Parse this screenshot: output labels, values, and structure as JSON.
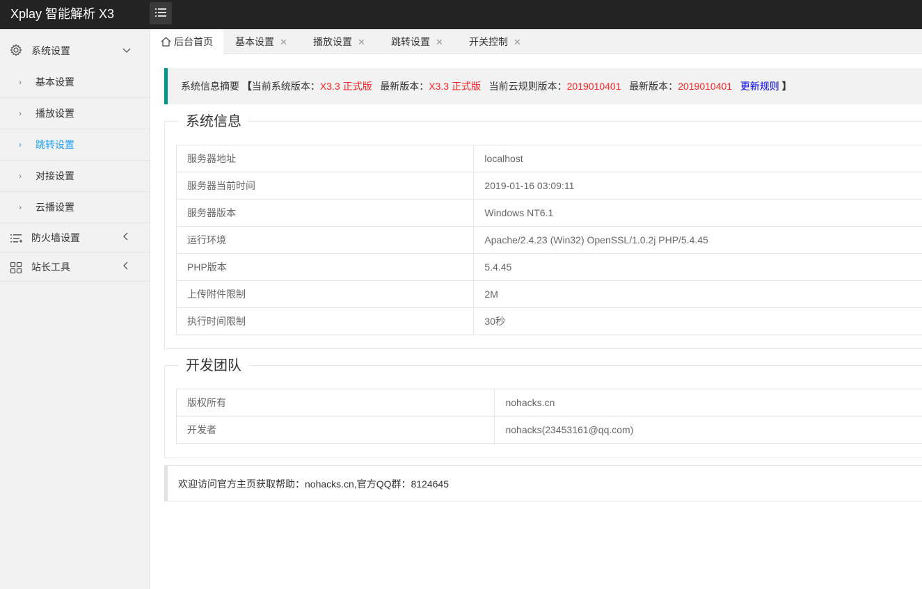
{
  "app": {
    "title": "Xplay 智能解析 X3"
  },
  "sidebar": {
    "groups": [
      {
        "label": "系统设置",
        "icon": "gear-icon",
        "expanded": true,
        "children": [
          {
            "label": "基本设置",
            "active": false
          },
          {
            "label": "播放设置",
            "active": false
          },
          {
            "label": "跳转设置",
            "active": true
          },
          {
            "label": "对接设置",
            "active": false
          },
          {
            "label": "云播设置",
            "active": false
          }
        ]
      },
      {
        "label": "防火墙设置",
        "icon": "list-icon",
        "expanded": false
      },
      {
        "label": "站长工具",
        "icon": "grid-icon",
        "expanded": false
      }
    ]
  },
  "tabs": [
    {
      "label": "后台首页",
      "active": true
    },
    {
      "label": "基本设置",
      "close": "✕"
    },
    {
      "label": "播放设置",
      "close": "✕"
    },
    {
      "label": "跳转设置",
      "close": "✕"
    },
    {
      "label": "开关控制",
      "close": "✕"
    }
  ],
  "summary": {
    "prefix": "系统信息摘要",
    "open_bracket": "【",
    "current_version_label": "当前系统版本：",
    "current_version": "X3.3 正式版",
    "latest_version_label": "最新版本：",
    "latest_version": "X3.3 正式版",
    "current_rule_label": "当前云规则版本：",
    "current_rule": "2019010401",
    "latest_rule_label": "最新版本：",
    "latest_rule": "2019010401",
    "update_link": "更新规则",
    "close_bracket": "】"
  },
  "system_info": {
    "title": "系统信息",
    "rows": [
      {
        "key": "服务器地址",
        "value": "localhost"
      },
      {
        "key": "服务器当前时间",
        "value": "2019-01-16 03:09:11"
      },
      {
        "key": "服务器版本",
        "value": "Windows NT6.1"
      },
      {
        "key": "运行环境",
        "value": "Apache/2.4.23 (Win32) OpenSSL/1.0.2j PHP/5.4.45"
      },
      {
        "key": "PHP版本",
        "value": "5.4.45"
      },
      {
        "key": "上传附件限制",
        "value": "2M"
      },
      {
        "key": "执行时间限制",
        "value": "30秒"
      }
    ]
  },
  "team": {
    "title": "开发团队",
    "rows": [
      {
        "key": "版权所有",
        "value": "nohacks.cn"
      },
      {
        "key": "开发者",
        "value": "nohacks(23453161@qq.com)"
      }
    ]
  },
  "footer": {
    "text": "欢迎访问官方主页获取帮助：nohacks.cn,官方QQ群：8124645"
  },
  "colors": {
    "accent": "#009688",
    "active": "#1e9fff",
    "highlight": "#ff2222",
    "link": "#0000ee",
    "topbar": "#232323"
  }
}
